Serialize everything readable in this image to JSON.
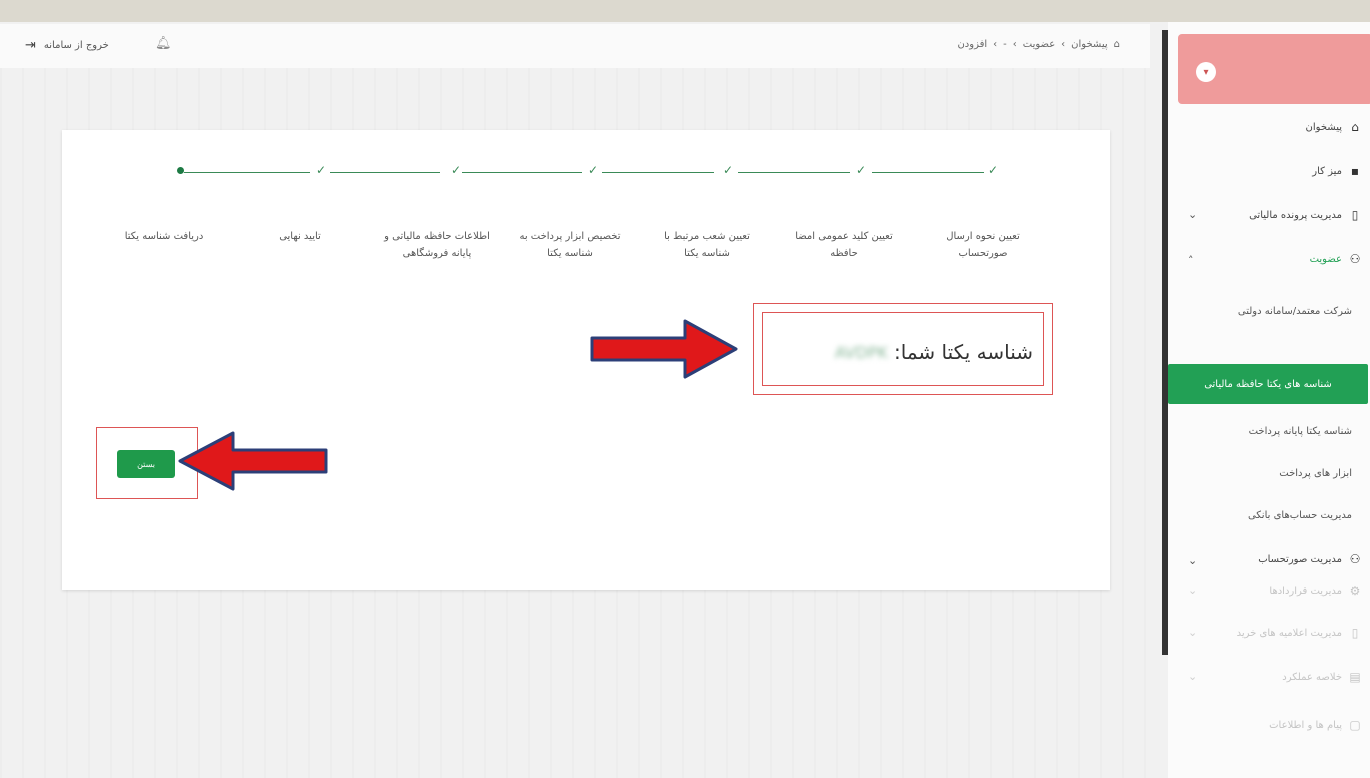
{
  "header": {
    "logout_label": "خروج از سامانه",
    "breadcrumb": [
      "پیشخوان",
      "عضویت",
      "-",
      "افزودن"
    ]
  },
  "sidebar": {
    "items": [
      {
        "label": "پیشخوان",
        "icon": "home-icon"
      },
      {
        "label": "میز کار",
        "icon": "briefcase-icon"
      },
      {
        "label": "مدیریت پرونده مالیاتی",
        "icon": "folder-icon"
      },
      {
        "label": "عضویت",
        "icon": "user-icon"
      }
    ],
    "sub_items": [
      "شرکت معتمد/سامانه دولتی",
      "شناسه های یکتا حافظه مالیاتی",
      "شناسه یکتا پایانه پرداخت",
      "ابزار های پرداخت",
      "مدیریت حساب‌های بانکی"
    ],
    "invoice_management": "مدیریت صورتحساب",
    "faded_items": [
      "مدیریت قراردادها",
      "مدیریت اعلامیه های خرید",
      "خلاصه عملکرد",
      "پیام ها و اطلاعات"
    ]
  },
  "stepper": {
    "steps": [
      "تعیین نحوه ارسال صورتحساب",
      "تعیین کلید عمومی امضا حافظه",
      "تعیین شعب مرتبط با شناسه یکتا",
      "تخصیص ابزار پرداخت به شناسه یکتا",
      "اطلاعات حافظه مالیاتی و پایانه فروشگاهی",
      "تایید نهایی",
      "دریافت شناسه یکتا"
    ]
  },
  "result": {
    "label": "شناسه یکتا شما:",
    "value": "AVDPK"
  },
  "actions": {
    "close_label": "بستن"
  },
  "colors": {
    "accent": "#22a055",
    "annotation_red": "#e0181a",
    "annotation_border": "#2c3f78"
  }
}
